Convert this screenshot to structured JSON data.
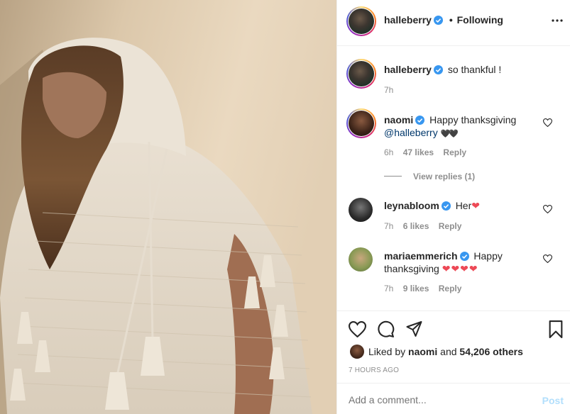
{
  "post": {
    "photo_alt": "photo",
    "author": "halleberry",
    "follow_separator": "•",
    "follow_label": "Following",
    "more_icon": "more-options-icon"
  },
  "caption": {
    "username": "halleberry",
    "text": "so thankful !",
    "time": "7h"
  },
  "comments": [
    {
      "username": "naomi",
      "text": "Happy thanksgiving",
      "mention": "@halleberry",
      "emoji": "🖤🖤",
      "time": "6h",
      "likes": "47 likes",
      "reply": "Reply",
      "view_replies": "View replies (1)"
    },
    {
      "username": "leynabloom",
      "text": "Her",
      "emoji": "❤",
      "time": "7h",
      "likes": "6 likes",
      "reply": "Reply"
    },
    {
      "username": "mariaemmerich",
      "text1": "Happy",
      "text2": "thanksgiving",
      "emoji": "❤❤❤❤",
      "time": "7h",
      "likes": "9 likes",
      "reply": "Reply"
    }
  ],
  "actions": {
    "liked_by_prefix": "Liked by",
    "liked_by_user": "naomi",
    "liked_by_and": "and",
    "liked_by_count": "54,206 others",
    "timestamp": "7 HOURS AGO"
  },
  "comment_form": {
    "placeholder": "Add a comment...",
    "post_label": "Post"
  },
  "colors": {
    "verified": "#3897f0",
    "heart": "#ed4956",
    "post_disabled": "#b2dffc"
  }
}
